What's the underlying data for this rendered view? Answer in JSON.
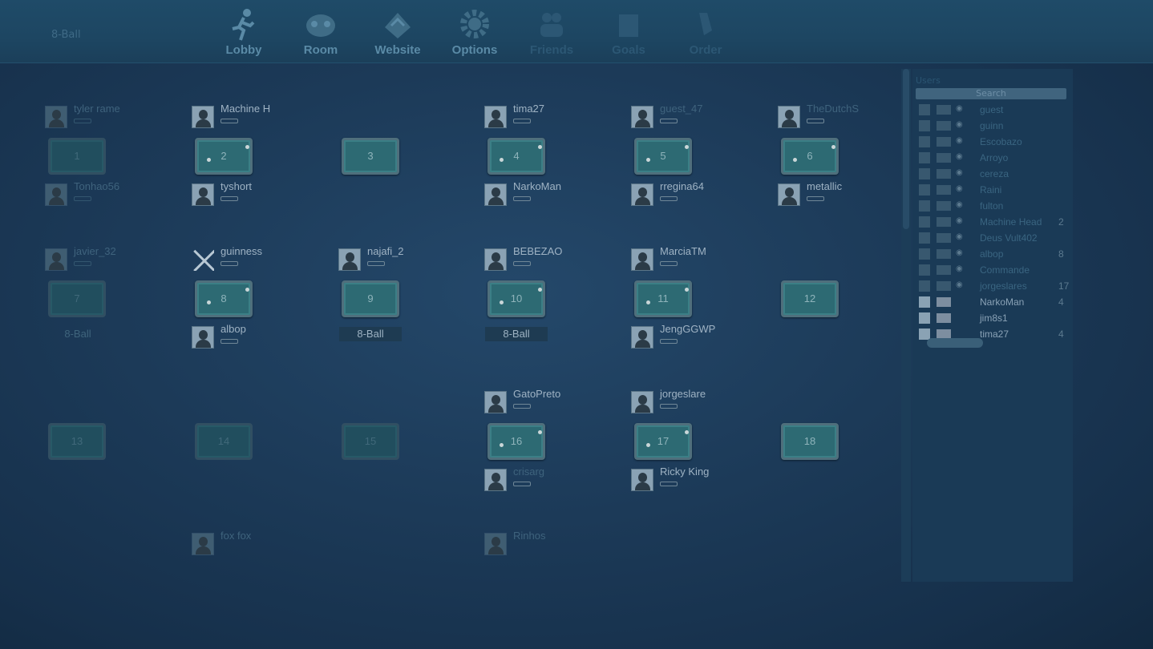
{
  "nav": {
    "items": [
      {
        "label": "Lobby",
        "icon": "running-man-icon"
      },
      {
        "label": "Room",
        "icon": "pool-room-icon"
      },
      {
        "label": "Website",
        "icon": "web-icon"
      },
      {
        "label": "Options",
        "icon": "gear-icon"
      },
      {
        "label": "Friends",
        "icon": "friends-icon"
      },
      {
        "label": "Goals",
        "icon": "goals-icon"
      },
      {
        "label": "Order",
        "icon": "order-icon"
      }
    ]
  },
  "header": {
    "title": "8-Ball"
  },
  "tables": [
    {
      "number": "1",
      "top": "tyler rame",
      "bottom": "Tonhao56"
    },
    {
      "number": "2",
      "top": "Machine H",
      "bottom": "tyshort"
    },
    {
      "number": "3",
      "top": "",
      "bottom": ""
    },
    {
      "number": "4",
      "top": "tima27",
      "bottom": "NarkoMan"
    },
    {
      "number": "5",
      "top": "guest_47",
      "bottom": "rregina64"
    },
    {
      "number": "6",
      "top": "TheDutchS",
      "bottom": "metallic"
    },
    {
      "number": "7",
      "top": "javier_32",
      "bottom": "",
      "game": "8-Ball"
    },
    {
      "number": "8",
      "top": "guinness",
      "bottom": "albop"
    },
    {
      "number": "9",
      "top": "najafi_2",
      "bottom": "",
      "game": "8-Ball"
    },
    {
      "number": "10",
      "top": "BEBEZAO",
      "bottom": "",
      "game": "8-Ball"
    },
    {
      "number": "11",
      "top": "MarciaTM",
      "bottom": "JengGGWP"
    },
    {
      "number": "12",
      "top": "",
      "bottom": ""
    },
    {
      "number": "13",
      "top": "",
      "bottom": ""
    },
    {
      "number": "14",
      "top": "",
      "bottom": ""
    },
    {
      "number": "15",
      "top": "",
      "bottom": ""
    },
    {
      "number": "16",
      "top": "GatoPreto",
      "bottom": "crisarg"
    },
    {
      "number": "17",
      "top": "jorgeslare",
      "bottom": "Ricky King"
    },
    {
      "number": "18",
      "top": "",
      "bottom": ""
    }
  ],
  "lower_row": {
    "players": [
      "fox fox",
      "Rinhos"
    ]
  },
  "user_list": {
    "header": "Users",
    "search_placeholder": "Search",
    "rows": [
      {
        "name": "guest",
        "table": ""
      },
      {
        "name": "guinn",
        "table": ""
      },
      {
        "name": "Escobazo",
        "table": ""
      },
      {
        "name": "Arroyo",
        "table": ""
      },
      {
        "name": "cereza",
        "table": ""
      },
      {
        "name": "Raini",
        "table": ""
      },
      {
        "name": "fulton",
        "table": ""
      },
      {
        "name": "Machine Head",
        "table": "2"
      },
      {
        "name": "Deus Vult402",
        "table": ""
      },
      {
        "name": "albop",
        "table": "8"
      },
      {
        "name": "Commande",
        "table": ""
      },
      {
        "name": "jorgeslares",
        "table": "17"
      },
      {
        "name": "NarkoMan",
        "table": "4"
      },
      {
        "name": "jim8s1",
        "table": ""
      },
      {
        "name": "tima27",
        "table": "4"
      }
    ]
  },
  "colors": {
    "background": "#1c3a58",
    "felt": "#2d6a73",
    "accent": "#5a8aa6"
  }
}
